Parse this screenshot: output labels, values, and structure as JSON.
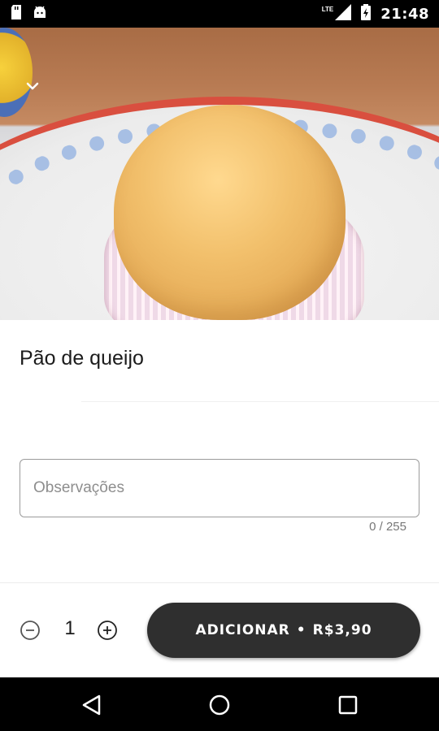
{
  "status_bar": {
    "time": "21:48",
    "network": "LTE",
    "icons": [
      "sd-card-icon",
      "android-icon",
      "signal-icon",
      "battery-icon"
    ]
  },
  "product": {
    "title": "Pão de queijo"
  },
  "notes": {
    "placeholder": "Observações",
    "value": "",
    "counter": "0 / 255"
  },
  "order": {
    "quantity": "1",
    "add_label": "ADICIONAR",
    "separator": "•",
    "price": "R$3,90"
  },
  "nav_bar": {
    "icons": [
      "back-icon",
      "home-icon",
      "recents-icon"
    ]
  },
  "colors": {
    "button_bg": "#2f2f2f",
    "button_text": "#ffffff",
    "border": "#9b9b9b"
  }
}
